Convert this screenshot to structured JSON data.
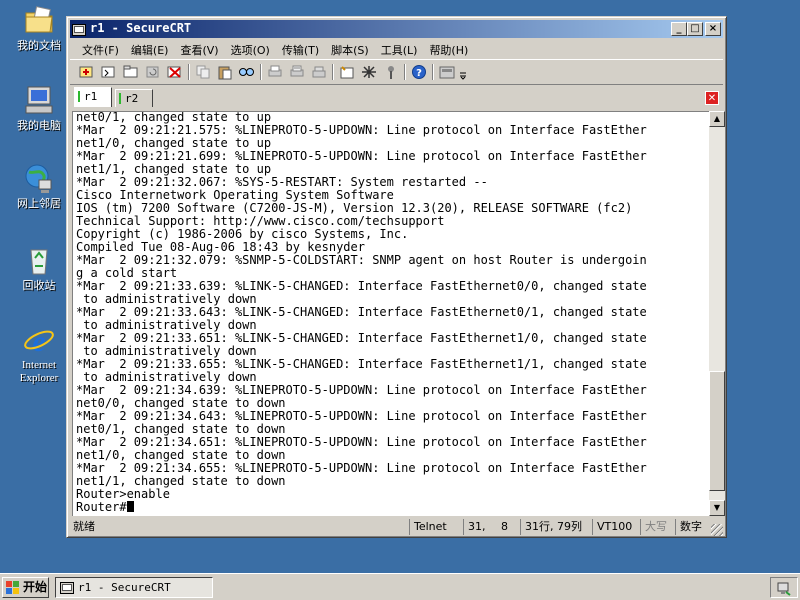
{
  "desktop": {
    "icons": [
      {
        "label": "我的文档",
        "icon": "my-documents-icon"
      },
      {
        "label": "我的电脑",
        "icon": "my-computer-icon"
      },
      {
        "label": "网上邻居",
        "icon": "network-places-icon"
      },
      {
        "label": "回收站",
        "icon": "recycle-bin-icon"
      },
      {
        "label": "Internet Explorer",
        "icon": "internet-explorer-icon"
      }
    ]
  },
  "window": {
    "title": "r1 - SecureCRT",
    "minimize": "_",
    "maximize": "□",
    "close": "×"
  },
  "menu": [
    "文件(F)",
    "编辑(E)",
    "查看(V)",
    "选项(O)",
    "传输(T)",
    "脚本(S)",
    "工具(L)",
    "帮助(H)"
  ],
  "tabs": [
    {
      "label": "r1",
      "active": true
    },
    {
      "label": "r2",
      "active": false
    }
  ],
  "terminal": {
    "lines": [
      "net0/1, changed state to up",
      "*Mar  2 09:21:21.575: %LINEPROTO-5-UPDOWN: Line protocol on Interface FastEther",
      "net1/0, changed state to up",
      "*Mar  2 09:21:21.699: %LINEPROTO-5-UPDOWN: Line protocol on Interface FastEther",
      "net1/1, changed state to up",
      "*Mar  2 09:21:32.067: %SYS-5-RESTART: System restarted --",
      "Cisco Internetwork Operating System Software",
      "IOS (tm) 7200 Software (C7200-JS-M), Version 12.3(20), RELEASE SOFTWARE (fc2)",
      "Technical Support: http://www.cisco.com/techsupport",
      "Copyright (c) 1986-2006 by cisco Systems, Inc.",
      "Compiled Tue 08-Aug-06 18:43 by kesnyder",
      "*Mar  2 09:21:32.079: %SNMP-5-COLDSTART: SNMP agent on host Router is undergoin",
      "g a cold start",
      "*Mar  2 09:21:33.639: %LINK-5-CHANGED: Interface FastEthernet0/0, changed state",
      " to administratively down",
      "*Mar  2 09:21:33.643: %LINK-5-CHANGED: Interface FastEthernet0/1, changed state",
      " to administratively down",
      "*Mar  2 09:21:33.651: %LINK-5-CHANGED: Interface FastEthernet1/0, changed state",
      " to administratively down",
      "*Mar  2 09:21:33.655: %LINK-5-CHANGED: Interface FastEthernet1/1, changed state",
      " to administratively down",
      "*Mar  2 09:21:34.639: %LINEPROTO-5-UPDOWN: Line protocol on Interface FastEther",
      "net0/0, changed state to down",
      "*Mar  2 09:21:34.643: %LINEPROTO-5-UPDOWN: Line protocol on Interface FastEther",
      "net0/1, changed state to down",
      "*Mar  2 09:21:34.651: %LINEPROTO-5-UPDOWN: Line protocol on Interface FastEther",
      "net1/0, changed state to down",
      "*Mar  2 09:21:34.655: %LINEPROTO-5-UPDOWN: Line protocol on Interface FastEther",
      "net1/1, changed state to down",
      "Router>enable"
    ],
    "prompt": "Router#"
  },
  "status": {
    "ready": "就绪",
    "protocol": "Telnet",
    "row": "31,",
    "col": "8",
    "size": "31行, 79列",
    "emulation": "VT100",
    "caps": "大写",
    "num": "数字"
  },
  "taskbar": {
    "start": "开始",
    "task": "r1 - SecureCRT"
  },
  "colors": {
    "desktop": "#3a6ea5",
    "titlebar_start": "#0a246a",
    "titlebar_end": "#a6caf0",
    "chrome": "#d4d0c8",
    "tab_active_mark": "#2eb82e",
    "tab_close": "#dd2222"
  }
}
